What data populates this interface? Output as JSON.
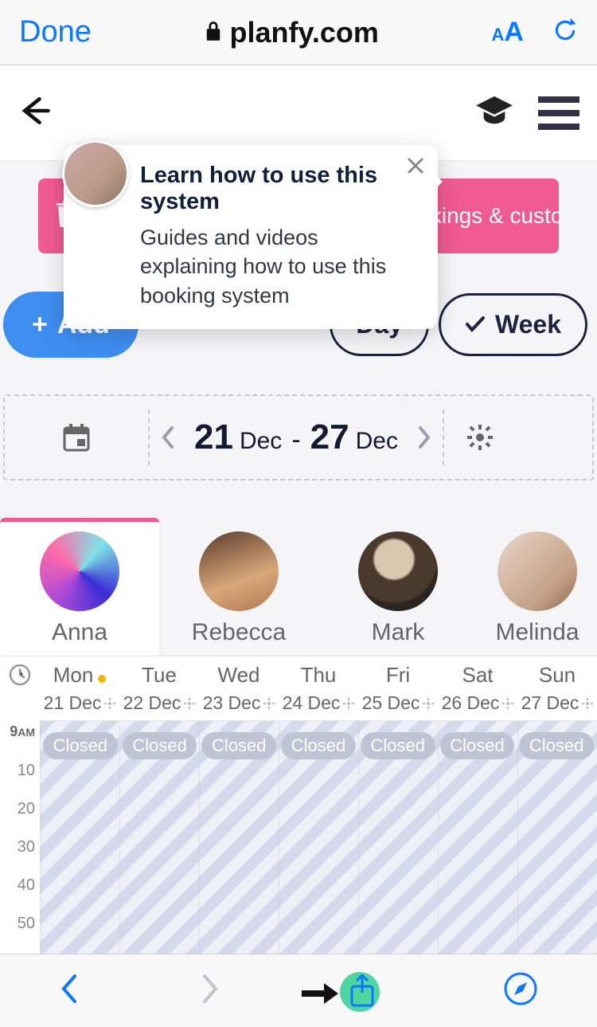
{
  "safari": {
    "done": "Done",
    "domain": "planfy.com"
  },
  "tooltip": {
    "title": "Learn how to use this system",
    "body": "Guides and videos explaining how to use this booking system"
  },
  "banner": {
    "text": "Click here to remove example bookings & customers."
  },
  "controls": {
    "add": "Add",
    "day": "Day",
    "week": "Week"
  },
  "dateRange": {
    "startDay": "21",
    "startMonth": "Dec",
    "endDay": "27",
    "endMonth": "Dec"
  },
  "staff": [
    {
      "name": "Anna",
      "active": true
    },
    {
      "name": "Rebecca",
      "active": false
    },
    {
      "name": "Mark",
      "active": false
    },
    {
      "name": "Melinda",
      "active": false
    }
  ],
  "days": [
    {
      "dow": "Mon",
      "date": "21 Dec",
      "today": true,
      "closed": "Closed"
    },
    {
      "dow": "Tue",
      "date": "22 Dec",
      "today": false,
      "closed": "Closed"
    },
    {
      "dow": "Wed",
      "date": "23 Dec",
      "today": false,
      "closed": "Closed"
    },
    {
      "dow": "Thu",
      "date": "24 Dec",
      "today": false,
      "closed": "Closed"
    },
    {
      "dow": "Fri",
      "date": "25 Dec",
      "today": false,
      "closed": "Closed"
    },
    {
      "dow": "Sat",
      "date": "26 Dec",
      "today": false,
      "closed": "Closed"
    },
    {
      "dow": "Sun",
      "date": "27 Dec",
      "today": false,
      "closed": "Closed"
    }
  ],
  "timeLabels": {
    "nine": "9",
    "am": "AM",
    "t10": "10",
    "t20": "20",
    "t30": "30",
    "t40": "40",
    "t50": "50"
  }
}
